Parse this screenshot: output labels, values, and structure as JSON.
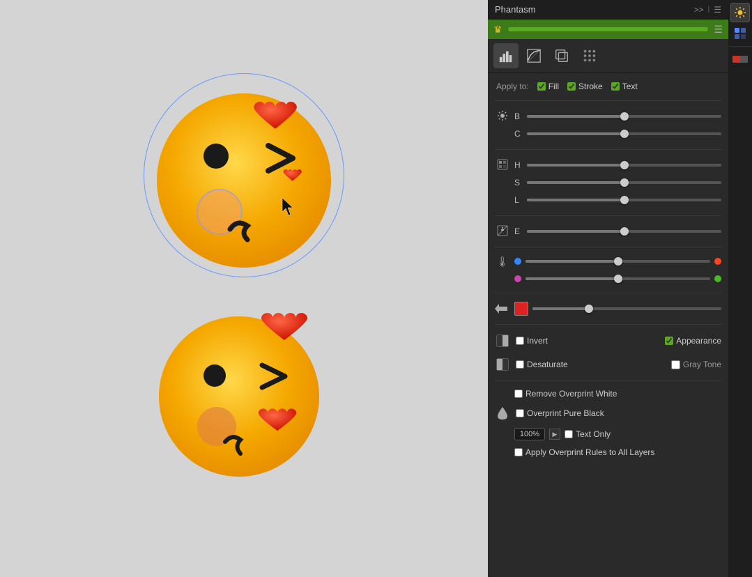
{
  "panel": {
    "title": "Phantasm",
    "more_icon": ">>",
    "menu_icon": "☰"
  },
  "crown_bar": {
    "icon": "♛"
  },
  "tabs": [
    {
      "id": "histogram",
      "label": "Histogram"
    },
    {
      "id": "curves",
      "label": "Curves"
    },
    {
      "id": "layers",
      "label": "Layers"
    },
    {
      "id": "dots",
      "label": "Dots"
    }
  ],
  "apply_to": {
    "label": "Apply to:",
    "fill": {
      "label": "Fill",
      "checked": true
    },
    "stroke": {
      "label": "Stroke",
      "checked": true
    },
    "text": {
      "label": "Text",
      "checked": true
    }
  },
  "sliders": {
    "brightness": {
      "label": "B",
      "value": 50
    },
    "contrast": {
      "label": "C",
      "value": 50
    },
    "hue": {
      "label": "H",
      "value": 50
    },
    "saturation": {
      "label": "S",
      "value": 50
    },
    "lightness": {
      "label": "L",
      "value": 50
    },
    "exposure": {
      "label": "E",
      "value": 50
    }
  },
  "temperature": {
    "row1_value": 50,
    "row2_value": 50
  },
  "color_slider": {
    "value": 30
  },
  "invert": {
    "label": "Invert",
    "checked": false,
    "appearance_label": "Appearance",
    "appearance_checked": true
  },
  "desaturate": {
    "label": "Desaturate",
    "checked": false,
    "gray_tone_label": "Gray Tone",
    "gray_tone_checked": false
  },
  "remove_overprint": {
    "label": "Remove Overprint White",
    "checked": false
  },
  "overprint_black": {
    "label": "Overprint Pure Black",
    "checked": false,
    "percent": "100%",
    "text_only_label": "Text Only",
    "text_only_checked": false
  },
  "apply_overprint_rules": {
    "label": "Apply Overprint Rules to All Layers",
    "checked": false
  },
  "right_toolbar": [
    {
      "id": "sun",
      "icon": "☀",
      "active": true
    },
    {
      "id": "grid",
      "icon": "⠿",
      "active": false
    },
    {
      "id": "color",
      "icon": "▬",
      "active": false
    }
  ]
}
